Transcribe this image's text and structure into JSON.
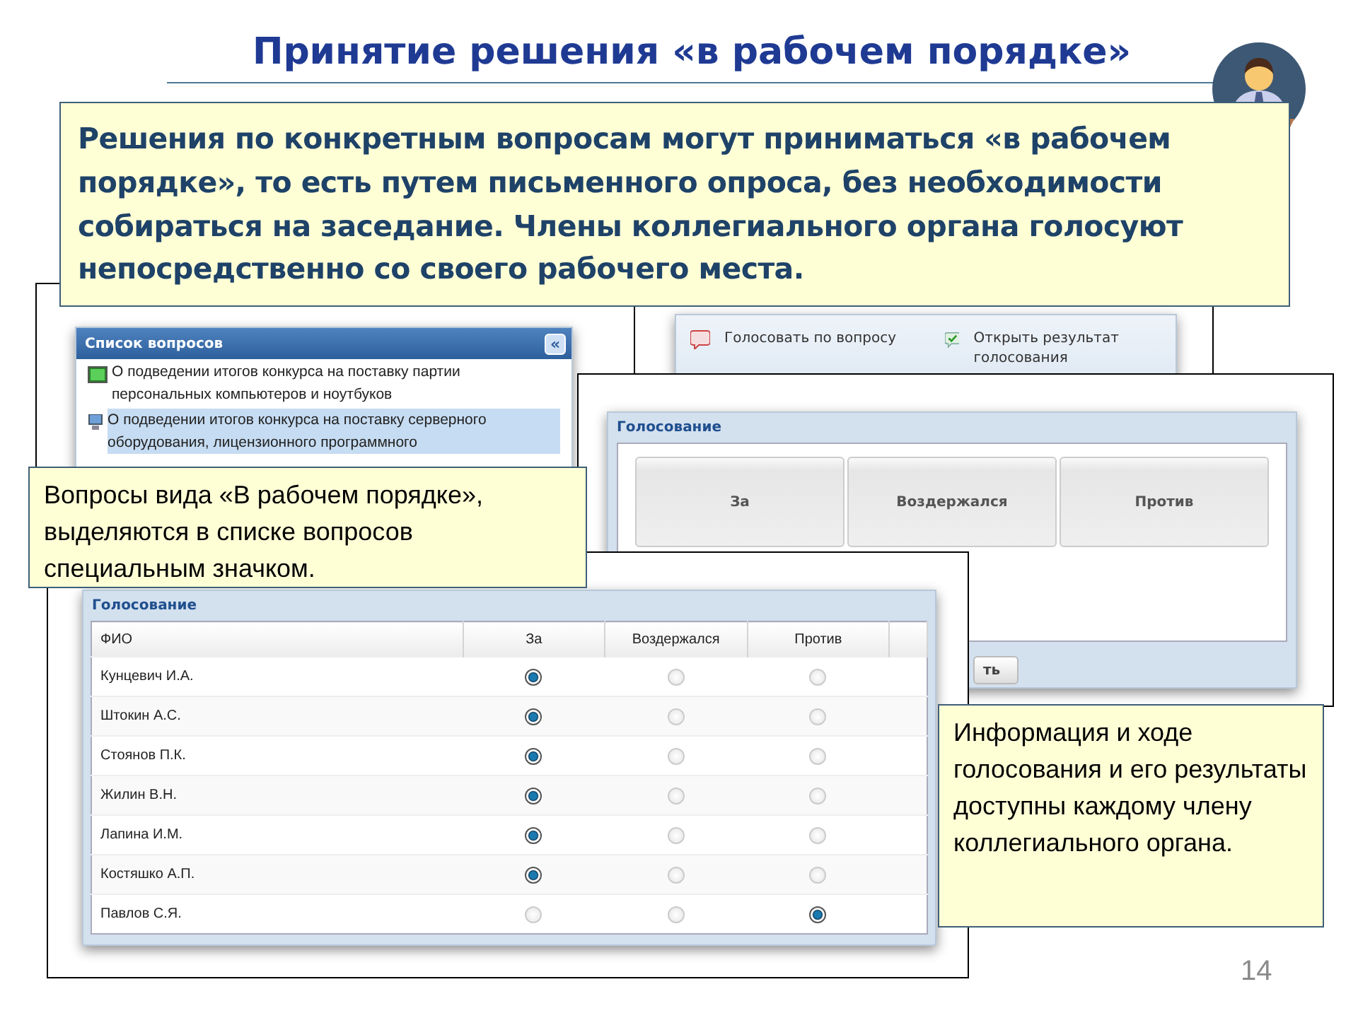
{
  "title": "Принятие решения «в рабочем порядке»",
  "intro": "Решения по конкретным вопросам могут приниматься «в рабочем порядке», то есть путем письменного опроса, без необходимости собираться на заседание. Члены коллегиального органа голосуют непосредственно со своего рабочего места.",
  "question_list": {
    "title": "Список вопросов",
    "collapse": "«",
    "items": [
      {
        "text": "О подведении итогов конкурса на поставку партии персональных компьютеров и ноутбуков",
        "kind": "meeting",
        "selected": false
      },
      {
        "text": "О подведении итогов конкурса на поставку серверного оборудования, лицензионного программного",
        "kind": "working",
        "selected": true
      }
    ]
  },
  "toolbar": {
    "items": [
      {
        "label": "Голосовать по вопросу",
        "kind": "vote"
      },
      {
        "label": "Открыть результат голосования",
        "kind": "result"
      }
    ]
  },
  "vote_panel": {
    "title": "Голосование",
    "options": [
      "За",
      "Воздержался",
      "Против"
    ],
    "button": "ть"
  },
  "callout_list": "Вопросы вида «В рабочем порядке», выделяются в списке вопросов специальным значком.",
  "results": {
    "title": "Голосование",
    "columns": [
      "ФИО",
      "За",
      "Воздержался",
      "Против"
    ],
    "rows": [
      {
        "name": "Кунцевич И.А.",
        "votes": [
          {
            "selected": true
          },
          {
            "selected": false
          },
          {
            "selected": false
          }
        ]
      },
      {
        "name": "Штокин А.С.",
        "votes": [
          {
            "selected": true
          },
          {
            "selected": false
          },
          {
            "selected": false
          }
        ]
      },
      {
        "name": "Стоянов П.К.",
        "votes": [
          {
            "selected": true
          },
          {
            "selected": false
          },
          {
            "selected": false
          }
        ]
      },
      {
        "name": "Жилин В.Н.",
        "votes": [
          {
            "selected": true
          },
          {
            "selected": false
          },
          {
            "selected": false
          }
        ]
      },
      {
        "name": "Лапина И.М.",
        "votes": [
          {
            "selected": true
          },
          {
            "selected": false
          },
          {
            "selected": false
          }
        ]
      },
      {
        "name": "Костяшко А.П.",
        "votes": [
          {
            "selected": true
          },
          {
            "selected": false
          },
          {
            "selected": false
          }
        ]
      },
      {
        "name": "Павлов С.Я.",
        "votes": [
          {
            "selected": false
          },
          {
            "selected": false
          },
          {
            "selected": true
          }
        ]
      }
    ]
  },
  "callout_results": "Информация и ходе голосования и его результаты доступны каждому члену коллегиального органа.",
  "page_number": "14"
}
